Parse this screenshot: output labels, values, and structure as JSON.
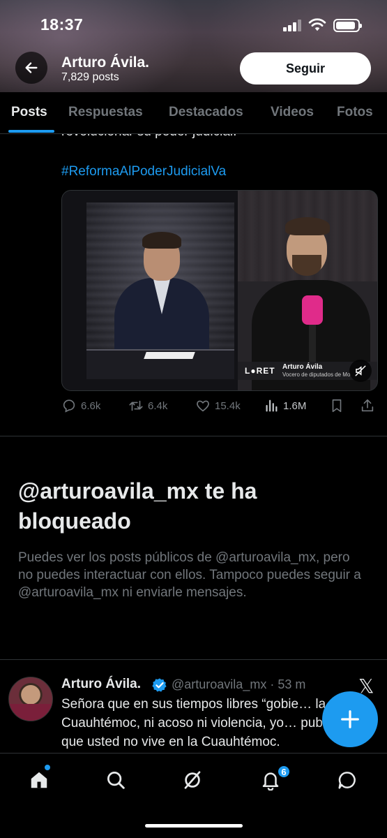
{
  "status_bar": {
    "time": "18:37"
  },
  "profile_header": {
    "name": "Arturo Ávila.",
    "post_count": "7,829 posts",
    "follow_label": "Seguir"
  },
  "tabs": [
    {
      "label": "Posts",
      "active": true
    },
    {
      "label": "Respuestas",
      "active": false
    },
    {
      "label": "Destacados",
      "active": false
    },
    {
      "label": "Videos",
      "active": false
    },
    {
      "label": "Fotos",
      "active": false
    }
  ],
  "post1": {
    "cut_text": "revolucionar su poder judicial.",
    "hashtag": "#ReformaAlPoderJudicialVa",
    "media": {
      "channel_logo": "L●RET",
      "lower_third_name": "Arturo Ávila",
      "lower_third_role": "Vocero de diputados de Mo"
    },
    "actions": {
      "replies": "6.6k",
      "reposts": "6.4k",
      "likes": "15.4k",
      "views": "1.6M"
    }
  },
  "blocked_notice": {
    "title": "@arturoavila_mx te ha bloqueado",
    "description": "Puedes ver los posts públicos de @arturoavila_mx, pero no puedes interactuar con ellos. Tampoco puedes seguir a @arturoavila_mx ni enviarle mensajes."
  },
  "post2": {
    "name": "Arturo Ávila.",
    "meta": "@arturoavila_mx · 53 m",
    "text": "Señora que en sus tiempos libres “gobie… la Cuauhtémoc, ni acoso ni violencia, yo… publiqué que usted no vive en la Cuauhtémoc."
  },
  "bottom_nav": {
    "notification_count": "6"
  },
  "colors": {
    "accent": "#1d9bf0",
    "background": "#000000",
    "text_primary": "#e7e9ea",
    "text_secondary": "#71767b"
  }
}
